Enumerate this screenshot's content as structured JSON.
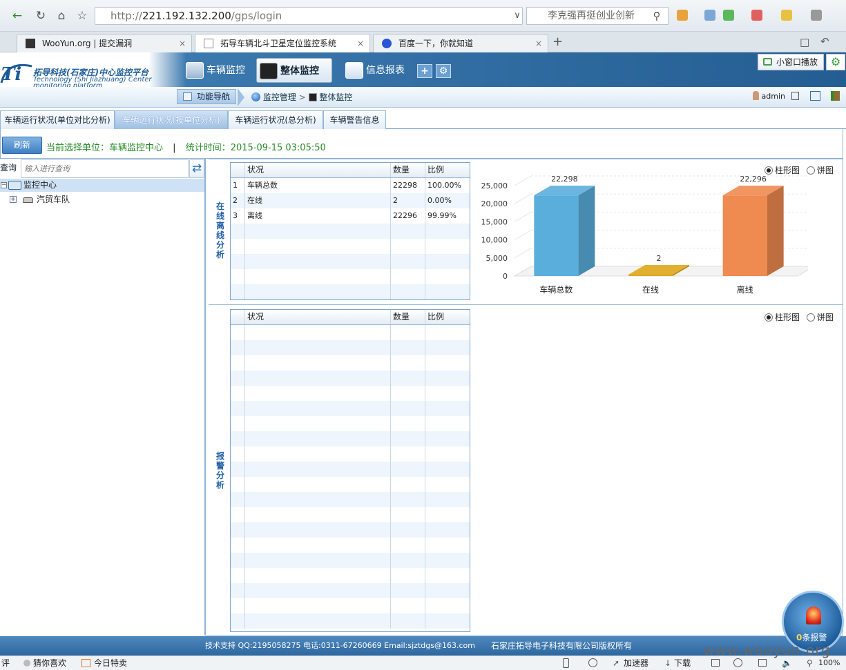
{
  "browser": {
    "url_prefix": "http://",
    "url_host": "221.192.132.200",
    "url_path": "/gps/login",
    "search_text": "李克强再挺创业创新",
    "tabs": [
      {
        "label": "WooYun.org | 提交漏洞",
        "active": false
      },
      {
        "label": "拓导车辆北斗卫星定位监控系统",
        "active": true
      },
      {
        "label": "百度一下，你就知道",
        "active": false
      }
    ],
    "new_tab": "+",
    "status_items": [
      "评",
      "猜你喜欢",
      "今日特卖",
      "加速器",
      "下载",
      "100%"
    ]
  },
  "app": {
    "logo_cn": "拓导科技(石家庄)中心监控平台",
    "logo_en_1": "Technology (Shi Jiazhuang) Center",
    "logo_en_2": "monitoring platform",
    "menu": [
      {
        "label": "车辆监控",
        "active": false
      },
      {
        "label": "整体监控",
        "active": true
      },
      {
        "label": "信息报表",
        "active": false
      }
    ],
    "mini_window": "小窗口播放",
    "func_nav": "功能导航",
    "crumb_1": "监控管理",
    "crumb_2": "整体监控",
    "user": "admin"
  },
  "subtabs": [
    {
      "label": "车辆运行状况(单位对比分析)",
      "active": false
    },
    {
      "label": "车辆运行状况(按单位分析)",
      "active": true
    },
    {
      "label": "车辆运行状况(总分析)",
      "active": false
    },
    {
      "label": "车辆警告信息",
      "active": false
    }
  ],
  "toolbar": {
    "refresh": "刷新",
    "unit_label": "当前选择单位：车辆监控中心",
    "sep": "|",
    "time_label": "统计时间：2015-09-15 03:05:50"
  },
  "tree": {
    "query_label": "查询",
    "query_placeholder": "输入进行查询",
    "root": "监控中心",
    "child": "汽贸车队"
  },
  "section1": {
    "label": "在线离线分析",
    "headers": [
      "状况",
      "数量",
      "比例"
    ],
    "rows": [
      {
        "no": "1",
        "status": "车辆总数",
        "count": "22298",
        "ratio": "100.00%"
      },
      {
        "no": "2",
        "status": "在线",
        "count": "2",
        "ratio": "0.00%"
      },
      {
        "no": "3",
        "status": "离线",
        "count": "22296",
        "ratio": "99.99%"
      }
    ],
    "radio_bar": "柱形图",
    "radio_pie": "饼图"
  },
  "section2": {
    "label": "报警分析",
    "headers": [
      "状况",
      "数量",
      "比例"
    ],
    "radio_bar": "柱形图",
    "radio_pie": "饼图"
  },
  "chart_data": {
    "type": "bar",
    "categories": [
      "车辆总数",
      "在线",
      "离线"
    ],
    "values": [
      22298,
      2,
      22296
    ],
    "value_labels": [
      "22,298",
      "2",
      "22,296"
    ],
    "colors": [
      "#5aaedc",
      "#e0a81c",
      "#ef8a50"
    ],
    "yticks": [
      "25,000",
      "20,000",
      "15,000",
      "10,000",
      "5,000",
      "0"
    ],
    "ylim": [
      0,
      25000
    ]
  },
  "footer": {
    "support": "技术支持 QQ:2195058275 电话:0311-67260669  Email:sjztdgs@163.com",
    "copyright": "石家庄拓导电子科技有限公司版权所有"
  },
  "alarm": {
    "count": "0",
    "label": "条报警"
  },
  "watermark": "www.wooyun.org"
}
